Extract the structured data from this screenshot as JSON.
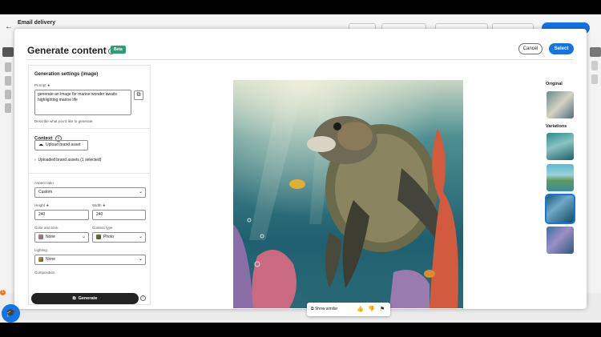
{
  "background": {
    "title": "Email delivery",
    "back_icon": "arrow-left-icon"
  },
  "modal": {
    "title": "Generate content",
    "beta": "Beta",
    "cancel": "Cancel",
    "select": "Select"
  },
  "settings": {
    "heading": "Generation settings (image)",
    "prompt_label": "Prompt",
    "prompt_value": "generate an image for marine wonder awaits highlighting marine life",
    "prompt_help": "Describe what you'd like to generate.",
    "context_heading": "Context",
    "upload_label": "Upload brand asset",
    "uploaded_assets": "Uploaded brand assets (1 selected)",
    "aspect_label": "Aspect ratio",
    "aspect_value": "Custom",
    "height_label": "Height",
    "height_value": "240",
    "width_label": "Width",
    "width_value": "240",
    "color_label": "Color and tone",
    "color_value": "None",
    "content_type_label": "Content type",
    "content_type_value": "Photo",
    "lighting_label": "Lighting",
    "lighting_value": "None",
    "composition_label": "Composition",
    "generate": "Generate"
  },
  "toolbar": {
    "show_similar": "Show similar"
  },
  "variations": {
    "original_label": "Original",
    "variations_label": "Variations"
  },
  "fab_badge": "1",
  "colors": {
    "accent": "#1473e6",
    "beta": "#2d9d78",
    "generate_bg": "#222222"
  }
}
